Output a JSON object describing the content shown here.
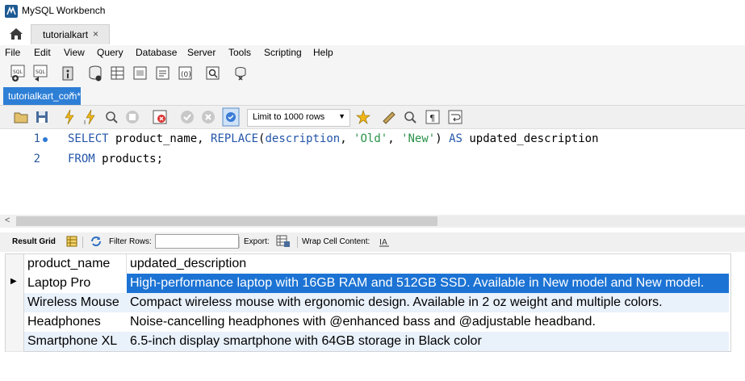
{
  "window": {
    "title": "MySQL Workbench"
  },
  "connection_tab": {
    "label": "tutorialkart",
    "close": "×"
  },
  "menu": [
    "File",
    "Edit",
    "View",
    "Query",
    "Database",
    "Server",
    "Tools",
    "Scripting",
    "Help"
  ],
  "sql_tab": {
    "label": "tutorialkart_com*",
    "close": "×"
  },
  "limit_select": {
    "value": "Limit to 1000 rows"
  },
  "editor": {
    "line_numbers": [
      "1",
      "2"
    ],
    "line1": {
      "kw1": "SELECT",
      "t1": " product_name, ",
      "fn": "REPLACE",
      "t2": "(",
      "kw2": "description",
      "t3": ", ",
      "s1": "'Old'",
      "t4": ", ",
      "s2": "'New'",
      "t5": ") ",
      "kw3": "AS",
      "t6": " updated_description"
    },
    "line2": {
      "kw1": "FROM",
      "t1": " products;"
    }
  },
  "result_toolbar": {
    "result_grid": "Result Grid",
    "filter_rows": "Filter Rows:",
    "filter_value": "",
    "export": "Export:",
    "wrap": "Wrap Cell Content:"
  },
  "grid": {
    "columns": [
      "product_name",
      "updated_description"
    ],
    "rows": [
      [
        "Laptop Pro",
        "High-performance laptop with 16GB RAM and 512GB SSD. Available in New model and New model."
      ],
      [
        "Wireless Mouse",
        "Compact wireless mouse with ergonomic design. Available in 2 oz weight and multiple colors."
      ],
      [
        "Headphones",
        "Noise-cancelling headphones with @enhanced bass and @adjustable headband."
      ],
      [
        "Smartphone XL",
        "6.5-inch display smartphone with 64GB storage in Black color"
      ]
    ],
    "selected_row": 0,
    "row_marker": "▶"
  },
  "colors": {
    "accent": "#2d7fd6",
    "selection": "#1c73d4",
    "keyword": "#2355a8",
    "string": "#2a9148",
    "alt_row": "#e9f1fb"
  },
  "icons": [
    "workbench-icon",
    "home-icon",
    "new-sql-icon",
    "open-sql-icon",
    "info-icon",
    "db-icon",
    "table-icon",
    "view-icon",
    "procedure-icon",
    "function-icon",
    "search-icon",
    "reconnect-icon",
    "folder-icon",
    "save-icon",
    "execute-icon",
    "execute-current-icon",
    "explain-icon",
    "stop-icon",
    "toggle-icon",
    "commit-icon",
    "rollback-icon",
    "autocommit-icon",
    "bookmark-icon",
    "brush-icon",
    "find-icon",
    "invisible-chars-icon",
    "wrap-icon",
    "grid-icon",
    "refresh-icon",
    "export-icon",
    "wrap-cell-icon"
  ]
}
